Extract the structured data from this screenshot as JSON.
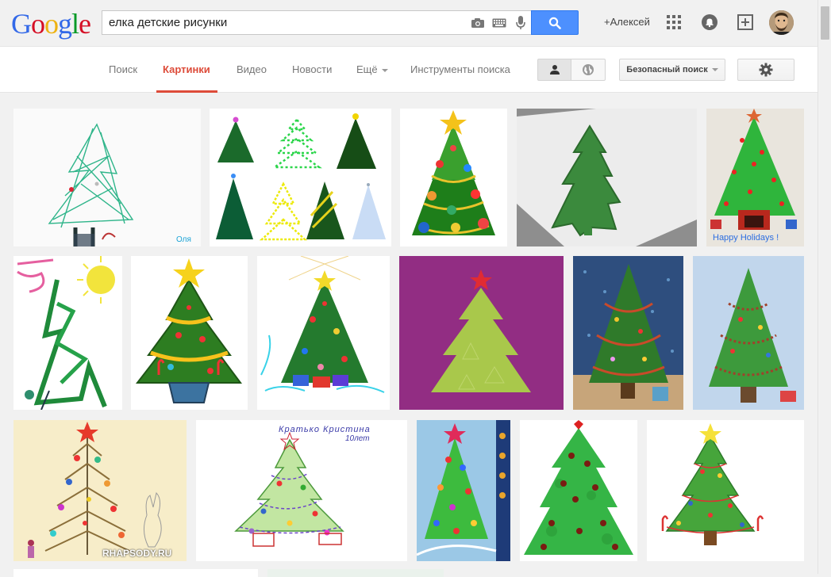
{
  "logo": {
    "letters": [
      "G",
      "o",
      "o",
      "g",
      "l",
      "e"
    ],
    "colors": [
      "#3369e8",
      "#d50f25",
      "#eeb211",
      "#3369e8",
      "#009925",
      "#d50f25"
    ]
  },
  "search": {
    "query": "елка детские рисунки"
  },
  "header": {
    "user_label": "+Алексей"
  },
  "nav": {
    "tabs": [
      {
        "label": "Поиск"
      },
      {
        "label": "Картинки"
      },
      {
        "label": "Видео"
      },
      {
        "label": "Новости"
      },
      {
        "label": "Ещё"
      },
      {
        "label": "Инструменты поиска"
      }
    ],
    "safe_search": "Безопасный поиск"
  },
  "images": {
    "caption_1": "Оля",
    "caption_5": "Happy Holidays !",
    "caption_13_line1": "Кратько Кристина",
    "caption_13_line2": "10лет",
    "caption_12": "RHAPSODY.RU"
  },
  "colors": {
    "accent": "#dd4b39",
    "search_blue": "#4d90fe"
  }
}
